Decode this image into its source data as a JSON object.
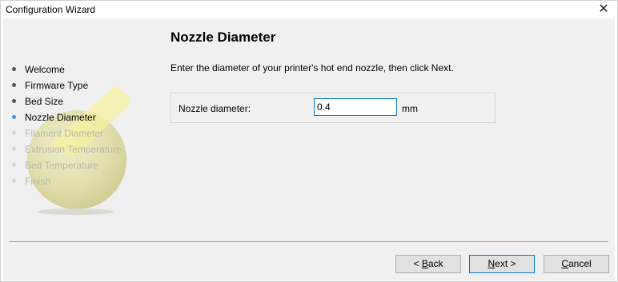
{
  "window": {
    "title": "Configuration Wizard",
    "close_glyph": "✕"
  },
  "sidebar": {
    "steps": [
      {
        "label": "Welcome",
        "state": "done"
      },
      {
        "label": "Firmware Type",
        "state": "done"
      },
      {
        "label": "Bed Size",
        "state": "done"
      },
      {
        "label": "Nozzle Diameter",
        "state": "current"
      },
      {
        "label": "Filament Diameter",
        "state": "todo"
      },
      {
        "label": "Extrusion Temperature",
        "state": "todo"
      },
      {
        "label": "Bed Temperature",
        "state": "todo"
      },
      {
        "label": "Finish",
        "state": "todo"
      }
    ]
  },
  "page": {
    "heading": "Nozzle Diameter",
    "description": "Enter the diameter of your printer's hot end nozzle, then click Next."
  },
  "form": {
    "nozzle_label": "Nozzle diameter:",
    "nozzle_value": "0.4",
    "unit": "mm"
  },
  "buttons": {
    "back": {
      "prefix": "< ",
      "accel": "B",
      "rest": "ack"
    },
    "next": {
      "prefix": "",
      "accel": "N",
      "rest": "ext >"
    },
    "cancel": {
      "prefix": "",
      "accel": "C",
      "rest": "ancel"
    }
  },
  "colors": {
    "current_step": "#3a9ad9",
    "focus_border": "#0078d7",
    "todo_text": "#b8b8a8"
  }
}
